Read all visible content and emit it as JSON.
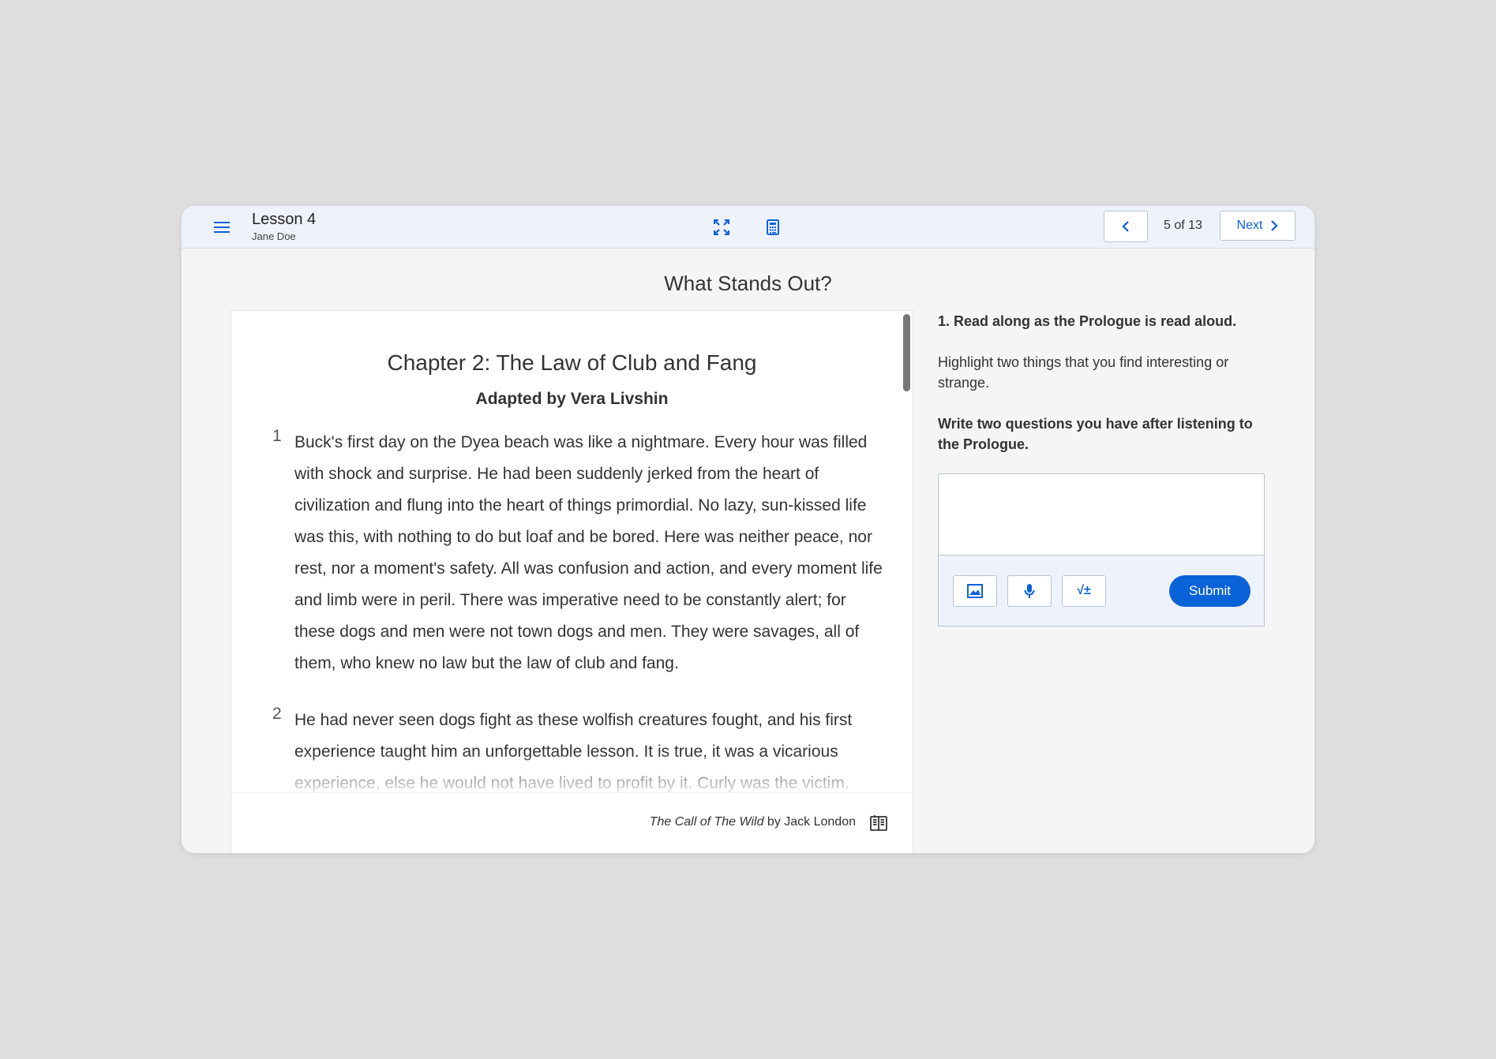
{
  "header": {
    "lesson_title": "Lesson 4",
    "student_name": "Jane Doe",
    "page_indicator": "5 of 13",
    "next_label": "Next"
  },
  "icons": {
    "menu": "menu-icon",
    "fullscreen": "fullscreen-icon",
    "calculator": "calculator-icon",
    "prev": "chevron-left-icon",
    "next": "chevron-right-icon",
    "source": "book-icon",
    "image": "image-icon",
    "mic": "microphone-icon",
    "equation": "equation-icon"
  },
  "colors": {
    "accent": "#0a62d8",
    "header_bg": "#eef2fa"
  },
  "page_title": "What Stands Out?",
  "reader": {
    "chapter_title": "Chapter 2: The Law of Club and Fang",
    "subtitle": "Adapted by Vera Livshin",
    "paragraphs": [
      {
        "number": "1",
        "text": "Buck's first day on the Dyea beach was like a nightmare. Every hour was filled with shock and surprise. He had been suddenly jerked from the heart of civilization and flung into the heart of things primordial. No lazy, sun-kissed life was this, with nothing to do but loaf and be bored. Here was neither peace, nor rest, nor a moment's safety. All was confusion and action, and every moment life and limb were in peril. There was imperative need to be constantly alert; for these dogs and men were not town dogs and men. They were savages, all of them, who knew no law but the law of club and fang."
      },
      {
        "number": "2",
        "text": "He had never seen dogs fight as these wolfish creatures fought, and his first experience taught him an unforgettable lesson. It is true, it was a vicarious experience, else he would not have lived to profit by it. Curly was the victim."
      }
    ],
    "source_title": "The Call of The Wild",
    "source_by": " by Jack London"
  },
  "questions": {
    "q1": "1. Read along as the Prologue is read aloud.",
    "q2": "Highlight two things that you find interesting or strange.",
    "q3": "Write two questions you have after listening to the Prologue.",
    "answer_value": "",
    "equation_label": "√±",
    "submit_label": "Submit"
  }
}
